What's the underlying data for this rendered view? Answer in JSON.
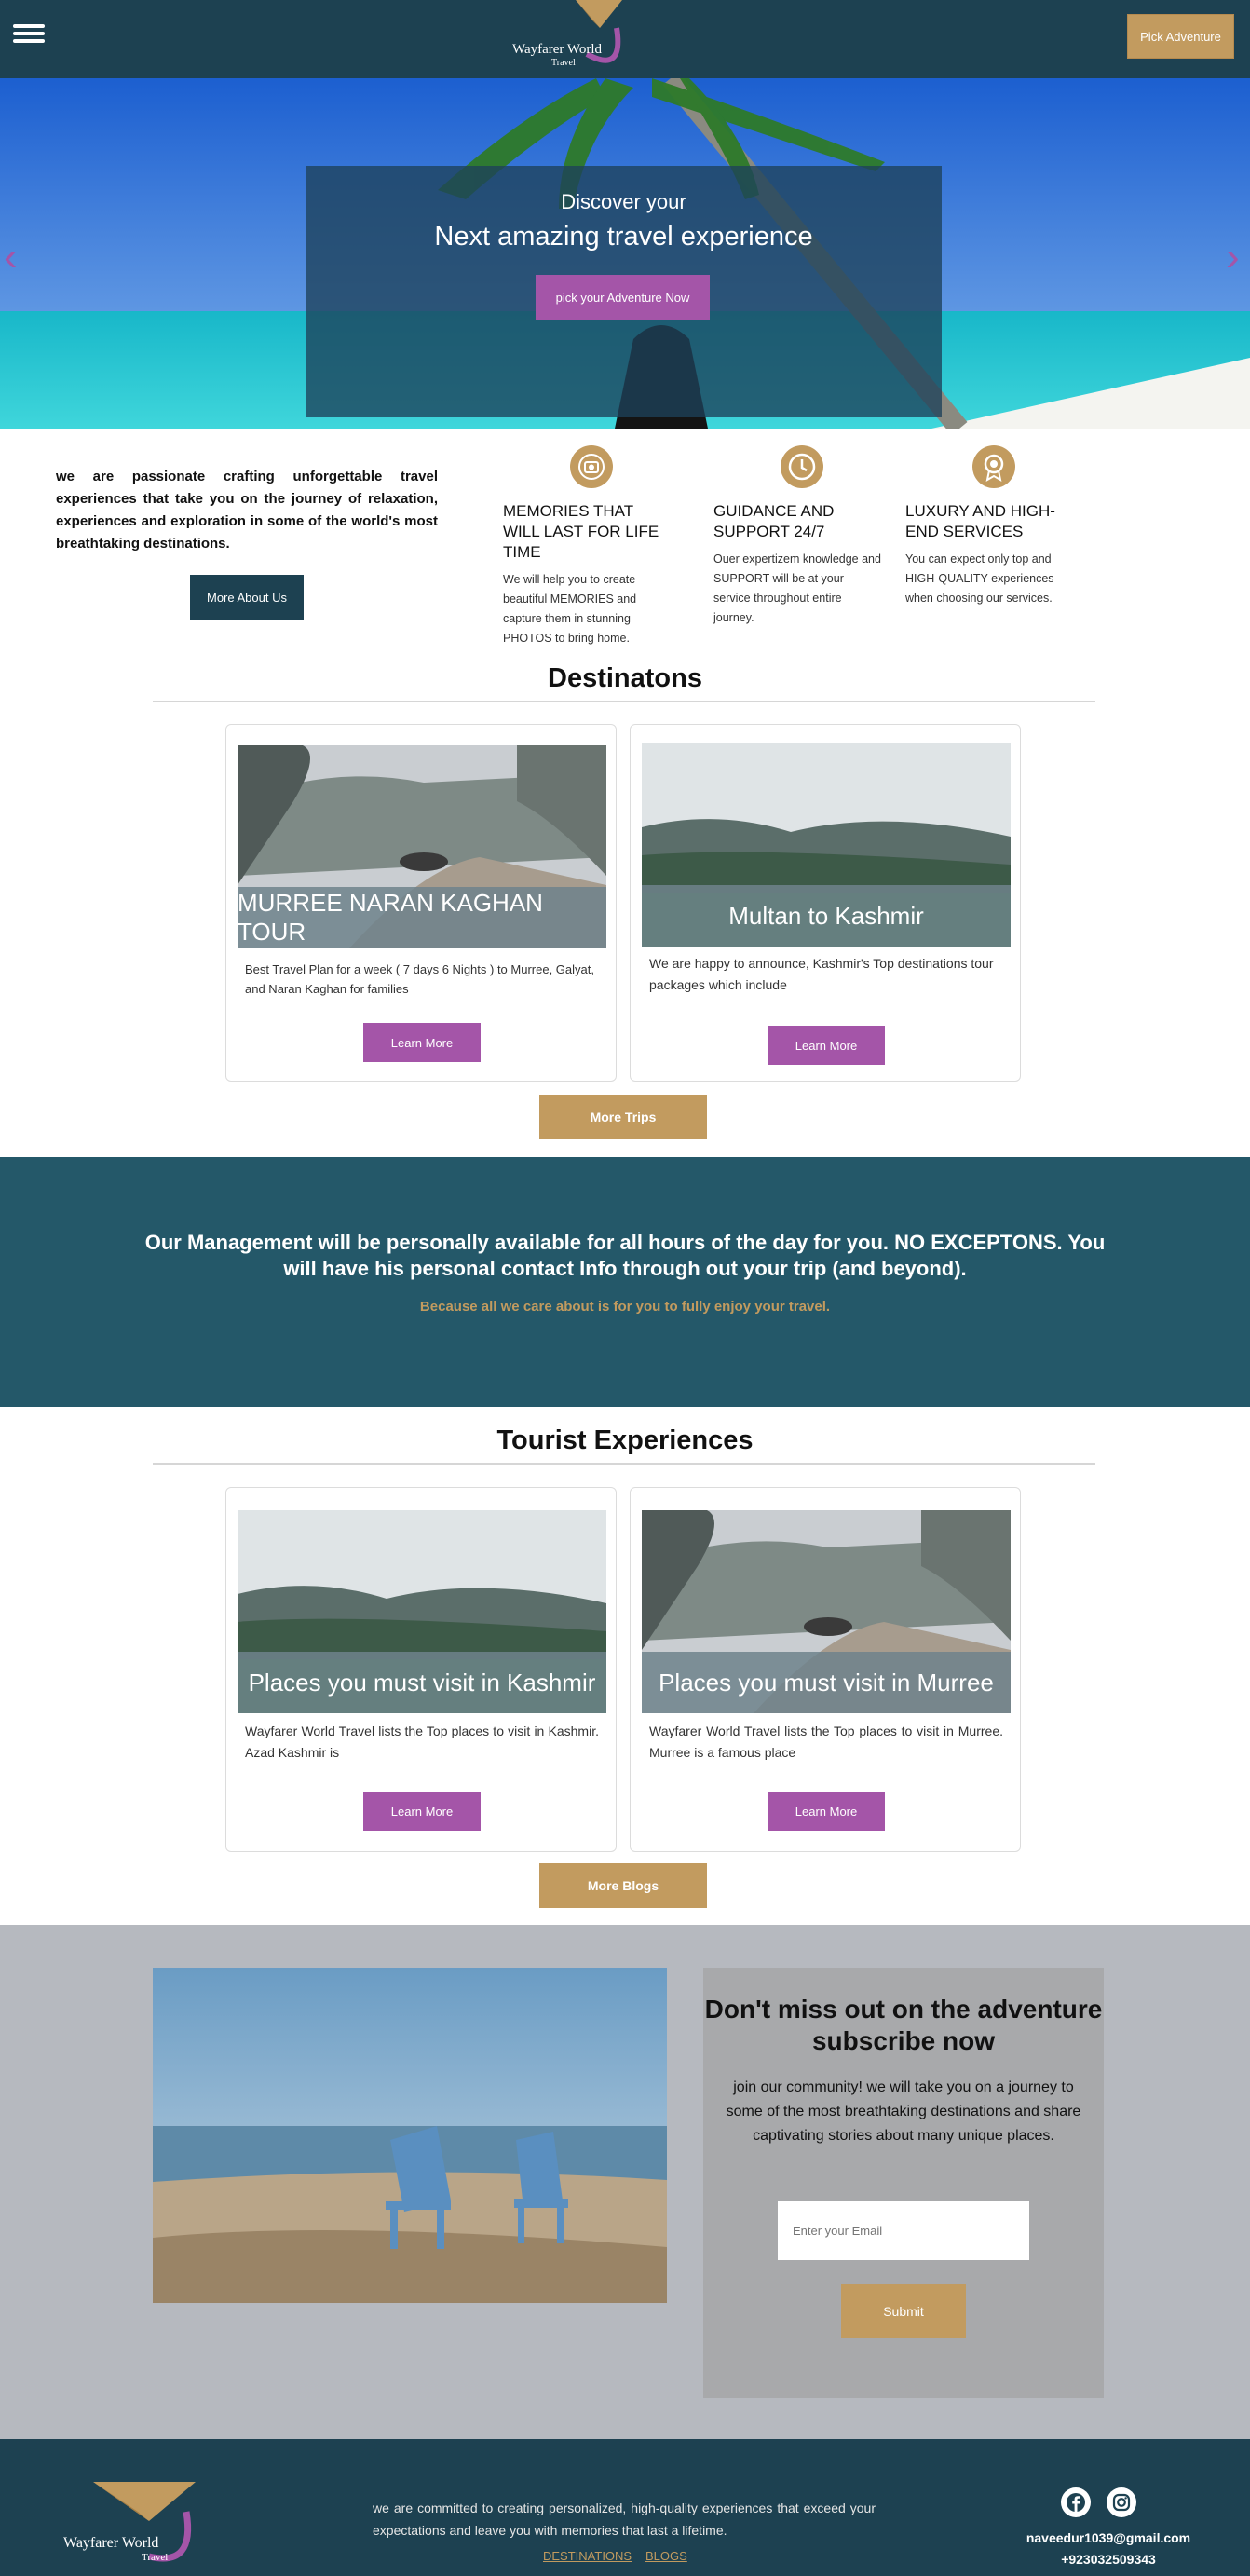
{
  "header": {
    "logo_text": "Wayfarer World",
    "logo_sub": "Travel",
    "pick_adventure": "Pick Adventure"
  },
  "hero": {
    "line1": "Discover your",
    "line2": "Next amazing travel experience",
    "button": "pick your Adventure Now"
  },
  "about": {
    "text": "we are passionate crafting unforgettable travel experiences that take you on the journey of relaxation, experiences and exploration in some of the world's most breathtaking destinations.",
    "button": "More About Us",
    "features": [
      {
        "title": "MEMORIES THAT WILL LAST FOR LIFE TIME",
        "desc": "We will help you to create beautiful MEMORIES and capture them in stunning PHOTOS to bring home.",
        "icon": "camera-icon"
      },
      {
        "title": "GUIDANCE AND SUPPORT 24/7",
        "desc": "Ouer expertizem knowledge and SUPPORT will be at your service throughout entire journey.",
        "icon": "clock-icon"
      },
      {
        "title": "LUXURY AND HIGH-END SERVICES",
        "desc": "You can expect only top and HIGH-QUALITY experiences when choosing our services.",
        "icon": "award-icon"
      }
    ]
  },
  "destinations": {
    "title": "Destinatons",
    "cards": [
      {
        "caption": "MURREE NARAN KAGHAN TOUR",
        "text": "Best Travel Plan for a week ( 7 days 6 Nights ) to Murree, Galyat, and Naran Kaghan for families",
        "button": "Learn More"
      },
      {
        "caption": "Multan to Kashmir",
        "text": "We are happy to announce, Kashmir's Top destinations tour packages which include",
        "button": "Learn More"
      }
    ],
    "more": "More Trips"
  },
  "band": {
    "heading": "Our Management will be personally available for all hours of the day for you. NO EXCEPTONS. You will have his personal contact Info through out your trip (and beyond).",
    "sub": "Because all we care about is for you to fully enjoy your travel."
  },
  "experiences": {
    "title": "Tourist Experiences",
    "cards": [
      {
        "caption": "Places you must visit in Kashmir",
        "text": "Wayfarer World Travel lists the Top places to visit in Kashmir. Azad Kashmir is",
        "button": "Learn More"
      },
      {
        "caption": "Places you must visit in Murree",
        "text": "Wayfarer World Travel lists the Top places to visit in Murree. Murree is a famous place",
        "button": "Learn More"
      }
    ],
    "more": "More Blogs"
  },
  "subscribe": {
    "heading": "Don't miss out on the adventure subscribe now",
    "text": "join our community! we will take you on a journey to some of the most breathtaking destinations and share captivating stories about many unique places.",
    "placeholder": "Enter your Email",
    "button": "Submit"
  },
  "footer": {
    "text": "we are committed to creating personalized, high-quality experiences that exceed your expectations and leave you with memories that last a lifetime.",
    "links": [
      "DESTINATIONS",
      "BLOGS"
    ],
    "email": "naveedur1039@gmail.com",
    "phone": "+923032509343",
    "social": [
      "facebook-icon",
      "instagram-icon"
    ]
  }
}
